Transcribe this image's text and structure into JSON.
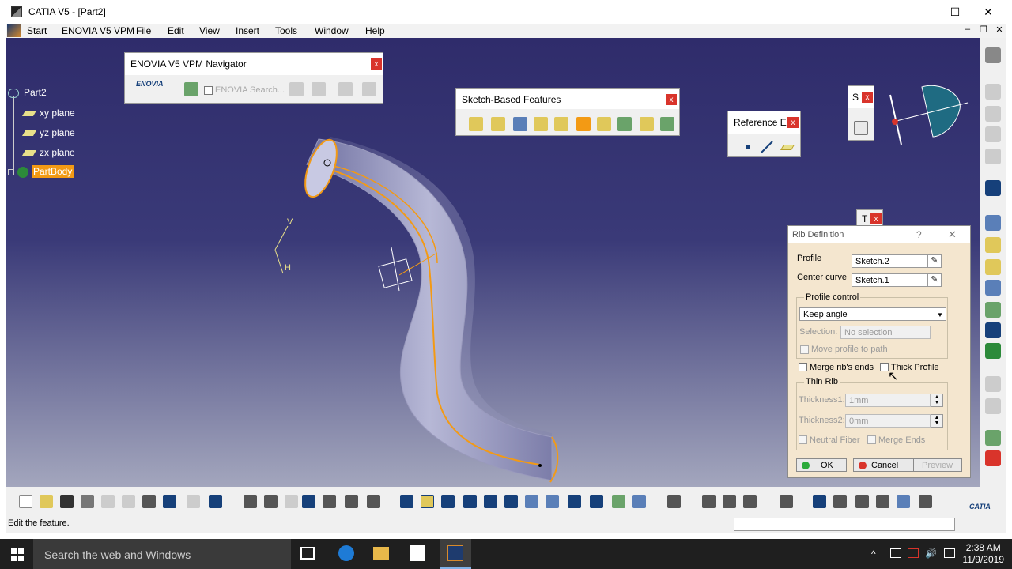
{
  "window": {
    "title": "CATIA V5 - [Part2]",
    "minimize": "—",
    "maximize": "☐",
    "close": "✕"
  },
  "menubar": {
    "items": [
      "Start",
      "ENOVIA V5 VPM",
      "File",
      "Edit",
      "View",
      "Insert",
      "Tools",
      "Window",
      "Help"
    ],
    "mdi_minimize": "–",
    "mdi_restore": "❐",
    "mdi_close": "✕"
  },
  "tree": {
    "root": "Part2",
    "planes": [
      "xy plane",
      "yz plane",
      "zx plane"
    ],
    "body": "PartBody"
  },
  "toolbars": {
    "enovia_navigator": {
      "title": "ENOVIA V5 VPM Navigator",
      "search_label": "ENOVIA Search...",
      "logo_text": "ENOVIA"
    },
    "sketch_features": {
      "title": "Sketch-Based Features"
    },
    "reference_elements": {
      "title": "Reference E..."
    },
    "sketcher_small": {
      "title": "S"
    },
    "tools_small": {
      "title": "T"
    },
    "close_label": "x"
  },
  "compass_axes": {
    "v": "V",
    "h": "H"
  },
  "rib_dialog": {
    "title": "Rib Definition",
    "help": "?",
    "close": "✕",
    "profile_label": "Profile",
    "profile_value": "Sketch.2",
    "center_curve_label": "Center curve",
    "center_curve_value": "Sketch.1",
    "profile_control_label": "Profile control",
    "profile_control_value": "Keep angle",
    "selection_label": "Selection:",
    "selection_value": "No selection",
    "move_profile_label": "Move profile to path",
    "merge_ends_label": "Merge rib's ends",
    "thick_profile_label": "Thick Profile",
    "thin_rib_label": "Thin Rib",
    "thickness1_label": "Thickness1:",
    "thickness1_value": "1mm",
    "thickness2_label": "Thickness2:",
    "thickness2_value": "0mm",
    "neutral_fiber_label": "Neutral Fiber",
    "merge_ends2_label": "Merge Ends",
    "ok_label": "OK",
    "cancel_label": "Cancel",
    "preview_label": "Preview"
  },
  "status": {
    "text": "Edit the feature."
  },
  "catia_logo": "CATIA",
  "taskbar": {
    "search_placeholder": "Search the web and Windows",
    "time": "2:38 AM",
    "date": "11/9/2019"
  },
  "colors": {
    "viewport_top": "#2f2c6b",
    "viewport_bottom": "#a3a6bd",
    "highlight_orange": "#f39a14",
    "close_red": "#d9342b",
    "dialog_bg": "#f4e6cf"
  }
}
